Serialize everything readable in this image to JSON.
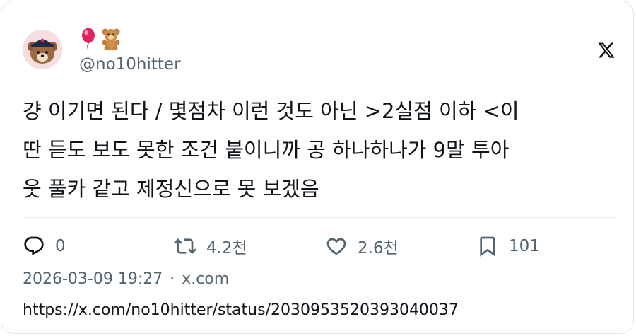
{
  "tweet": {
    "display_name_emojis": [
      "🎈",
      "🧸"
    ],
    "handle": "@no10hitter",
    "text_lines": [
      "걍 이기면 된다 / 몇점차 이런 것도 아닌 >2실점 이하 <이",
      "딴 듣도 보도 못한 조건 붙이니까 공 하나하나가 9말 투아",
      "웃 풀카 같고 제정신으로 못 보겠음"
    ],
    "actions": {
      "replies": "0",
      "retweets": "4.2천",
      "likes": "2.6천",
      "bookmarks": "101"
    },
    "timestamp": "2026-03-09 19:27",
    "separator": "·",
    "source": "x.com",
    "url": "https://x.com/no10hitter/status/2030953520393040037"
  },
  "icons": {
    "avatar": "bear-avatar-icon",
    "brand": "x-logo-icon",
    "reply": "reply-icon",
    "retweet": "retweet-icon",
    "like": "heart-icon",
    "bookmark": "bookmark-icon"
  },
  "colors": {
    "text": "#0f1419",
    "secondary": "#536471",
    "border": "#e1e8ed",
    "balloon": "#e0245e"
  }
}
